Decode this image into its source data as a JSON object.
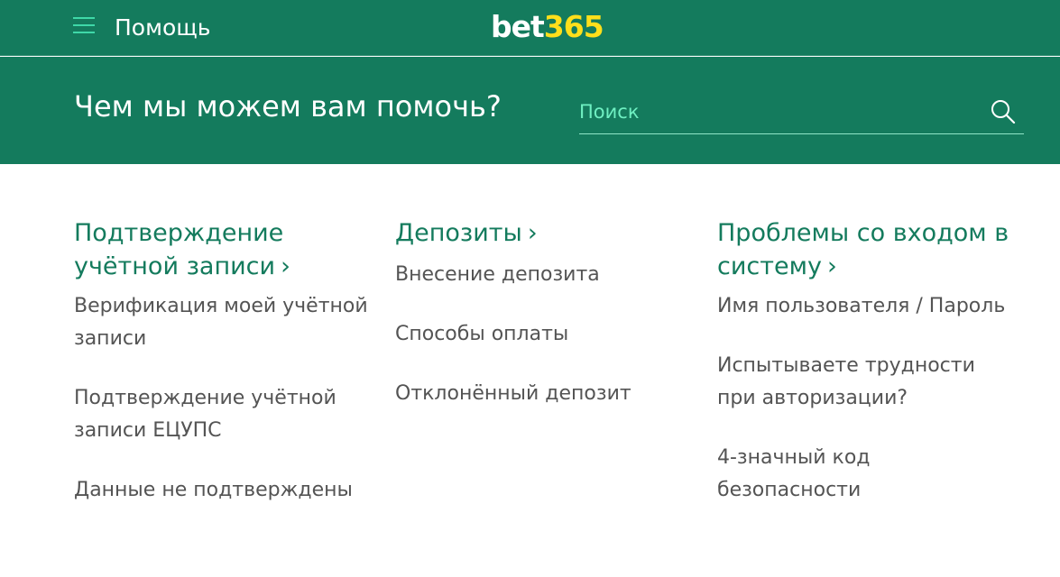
{
  "header": {
    "menu_icon": "hamburger-menu-icon",
    "title": "Помощь",
    "logo": {
      "part1": "bet",
      "part2": "365"
    },
    "colors": {
      "background": "#147b5d",
      "logo_accent": "#ffdf1b",
      "menu_icon": "#3fd8a8"
    }
  },
  "hero": {
    "title": "Чем мы можем вам помочь?",
    "search": {
      "placeholder": "Поиск",
      "value": "",
      "icon": "search-icon"
    }
  },
  "categories": [
    {
      "heading": "Подтверждение учётной записи",
      "chevron": "›",
      "links": [
        "Верификация моей учётной записи",
        "Подтверждение учётной записи ЕЦУПС",
        "Данные не подтверждены"
      ]
    },
    {
      "heading": "Депозиты",
      "chevron": "›",
      "links": [
        "Внесение депозита",
        "Способы оплаты",
        "Отклонённый депозит"
      ]
    },
    {
      "heading": "Проблемы со входом в систему",
      "chevron": "›",
      "links": [
        "Имя пользователя / Пароль",
        "Испытываете трудности при авторизации?",
        "4-значный код безопасности"
      ]
    }
  ]
}
